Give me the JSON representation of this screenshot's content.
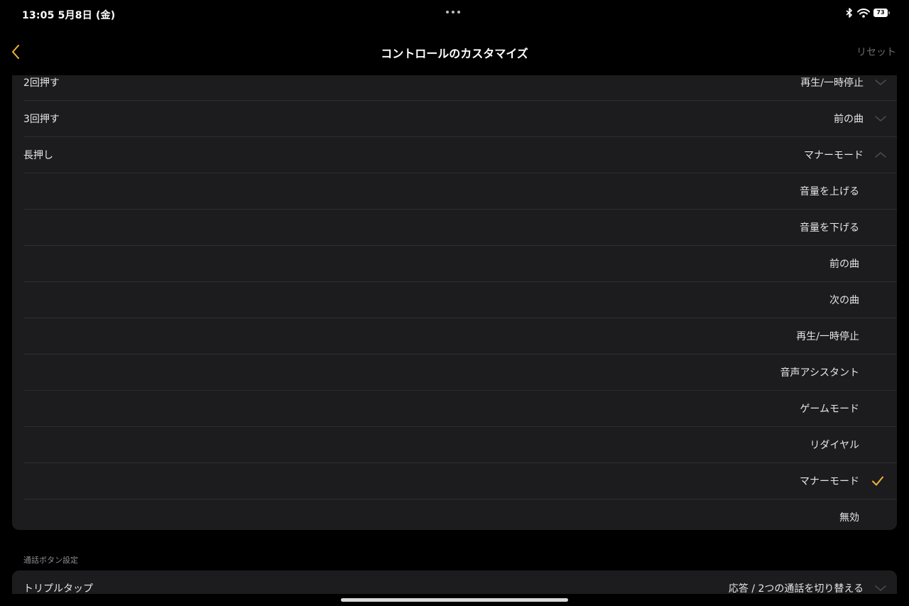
{
  "status_bar": {
    "time": "13:05  5月8日 (金)",
    "battery": "73",
    "icons": [
      "bluetooth-icon",
      "wifi-icon",
      "battery-icon"
    ]
  },
  "nav": {
    "title": "コントロールのカスタマイズ",
    "reset_label": "リセット",
    "accent_color": "#f5b335"
  },
  "settings_rows": [
    {
      "label": "2回押す",
      "value": "再生/一時停止",
      "chevron": "down"
    },
    {
      "label": "3回押す",
      "value": "前の曲",
      "chevron": "down"
    },
    {
      "label": "長押し",
      "value": "マナーモード",
      "chevron": "up"
    }
  ],
  "long_press_options": [
    {
      "label": "音量を上げる",
      "selected": false
    },
    {
      "label": "音量を下げる",
      "selected": false
    },
    {
      "label": "前の曲",
      "selected": false
    },
    {
      "label": "次の曲",
      "selected": false
    },
    {
      "label": "再生/一時停止",
      "selected": false
    },
    {
      "label": "音声アシスタント",
      "selected": false
    },
    {
      "label": "ゲームモード",
      "selected": false
    },
    {
      "label": "リダイヤル",
      "selected": false
    },
    {
      "label": "マナーモード",
      "selected": true
    },
    {
      "label": "無効",
      "selected": false
    }
  ],
  "call_section": {
    "header": "通話ボタン設定",
    "rows": [
      {
        "label": "トリプルタップ",
        "value": "応答 / 2つの通話を切り替える",
        "chevron": "down"
      }
    ]
  }
}
